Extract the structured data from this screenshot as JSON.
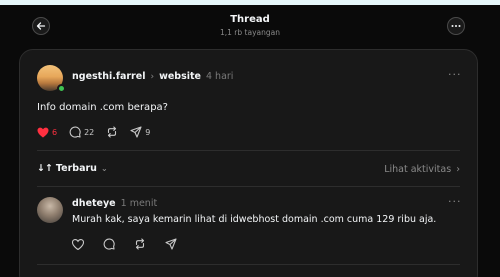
{
  "header": {
    "title": "Thread",
    "subtitle": "1,1 rb tayangan"
  },
  "post": {
    "username": "ngesthi.farrel",
    "topic": "website",
    "time": "4 hari",
    "text": "Info domain .com berapa?",
    "likes": "6",
    "comments": "22",
    "shares": "9"
  },
  "sort": {
    "label": "Terbaru",
    "activity_link": "Lihat aktivitas"
  },
  "reply": {
    "username": "dheteye",
    "time": "1 menit",
    "text": "Murah kak, saya kemarin lihat di idwebhost domain .com cuma 129 ribu aja."
  },
  "colors": {
    "background": "#0a0a0a",
    "panel": "#181818",
    "like_red": "#ff3040",
    "online_green": "#3ec252"
  }
}
